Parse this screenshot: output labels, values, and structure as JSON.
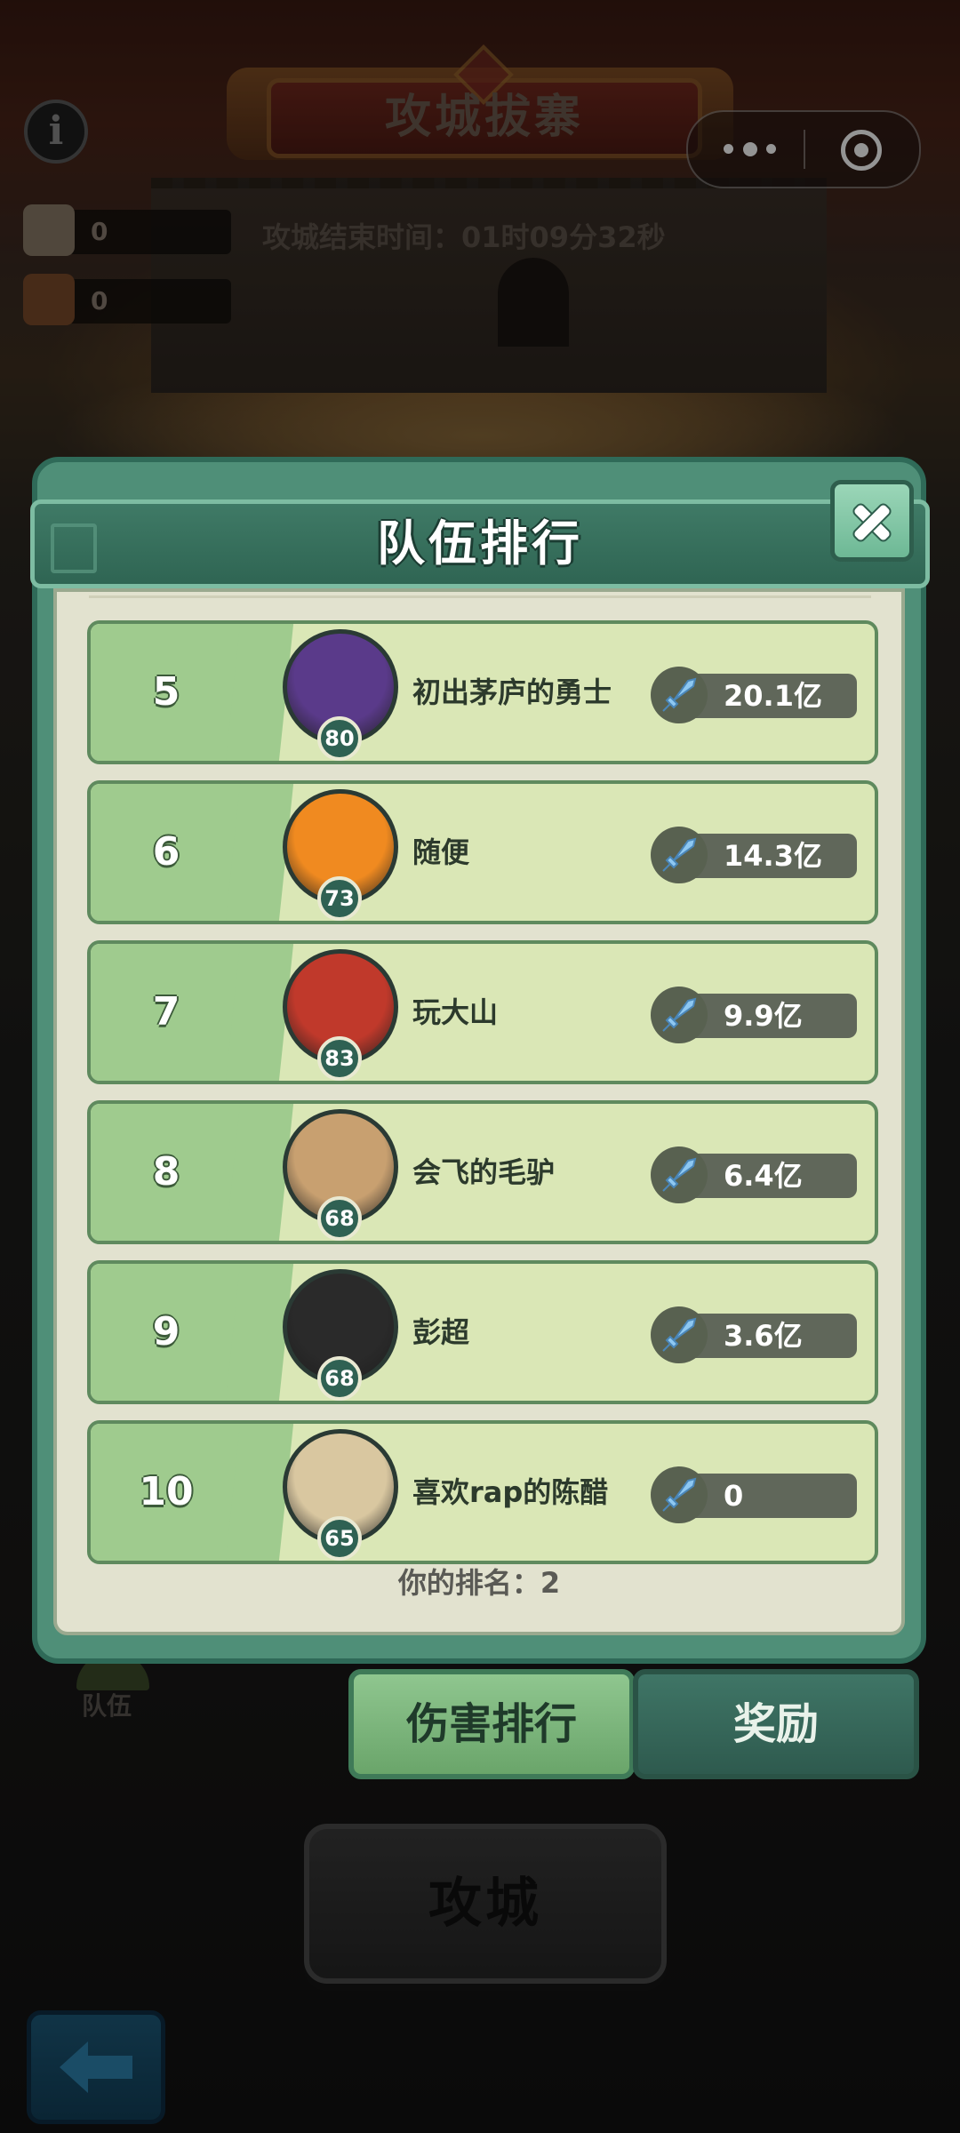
{
  "header": {
    "title": "攻城拔寨",
    "timer": "攻城结束时间：01时09分32秒"
  },
  "resources": [
    {
      "icon": "stone-icon",
      "value": "0"
    },
    {
      "icon": "scroll-icon",
      "value": "0"
    }
  ],
  "modal": {
    "title": "队伍排行",
    "my_rank": "你的排名：2",
    "rows": [
      {
        "rank": "5",
        "name": "初出茅庐的勇士",
        "level": "80",
        "power": "20.1亿",
        "avatar_color": "#5a3a8a"
      },
      {
        "rank": "6",
        "name": "随便",
        "level": "73",
        "power": "14.3亿",
        "avatar_color": "#f08a20"
      },
      {
        "rank": "7",
        "name": "玩大山",
        "level": "83",
        "power": "9.9亿",
        "avatar_color": "#c0392b"
      },
      {
        "rank": "8",
        "name": "会飞的毛驴",
        "level": "68",
        "power": "6.4亿",
        "avatar_color": "#c8a070"
      },
      {
        "rank": "9",
        "name": "彭超",
        "level": "68",
        "power": "3.6亿",
        "avatar_color": "#2a2a2a"
      },
      {
        "rank": "10",
        "name": "喜欢rap的陈醋",
        "level": "65",
        "power": "0",
        "avatar_color": "#d9c7a0"
      }
    ]
  },
  "tabs": {
    "damage": "伤害排行",
    "reward": "奖励"
  },
  "team_label": "队伍",
  "attack_button": "攻城",
  "colors": {
    "panel_green": "#4f8f78",
    "row_bg": "#dae7b6",
    "rank_strip": "#9fcb8e",
    "power_pill": "#60675a"
  }
}
